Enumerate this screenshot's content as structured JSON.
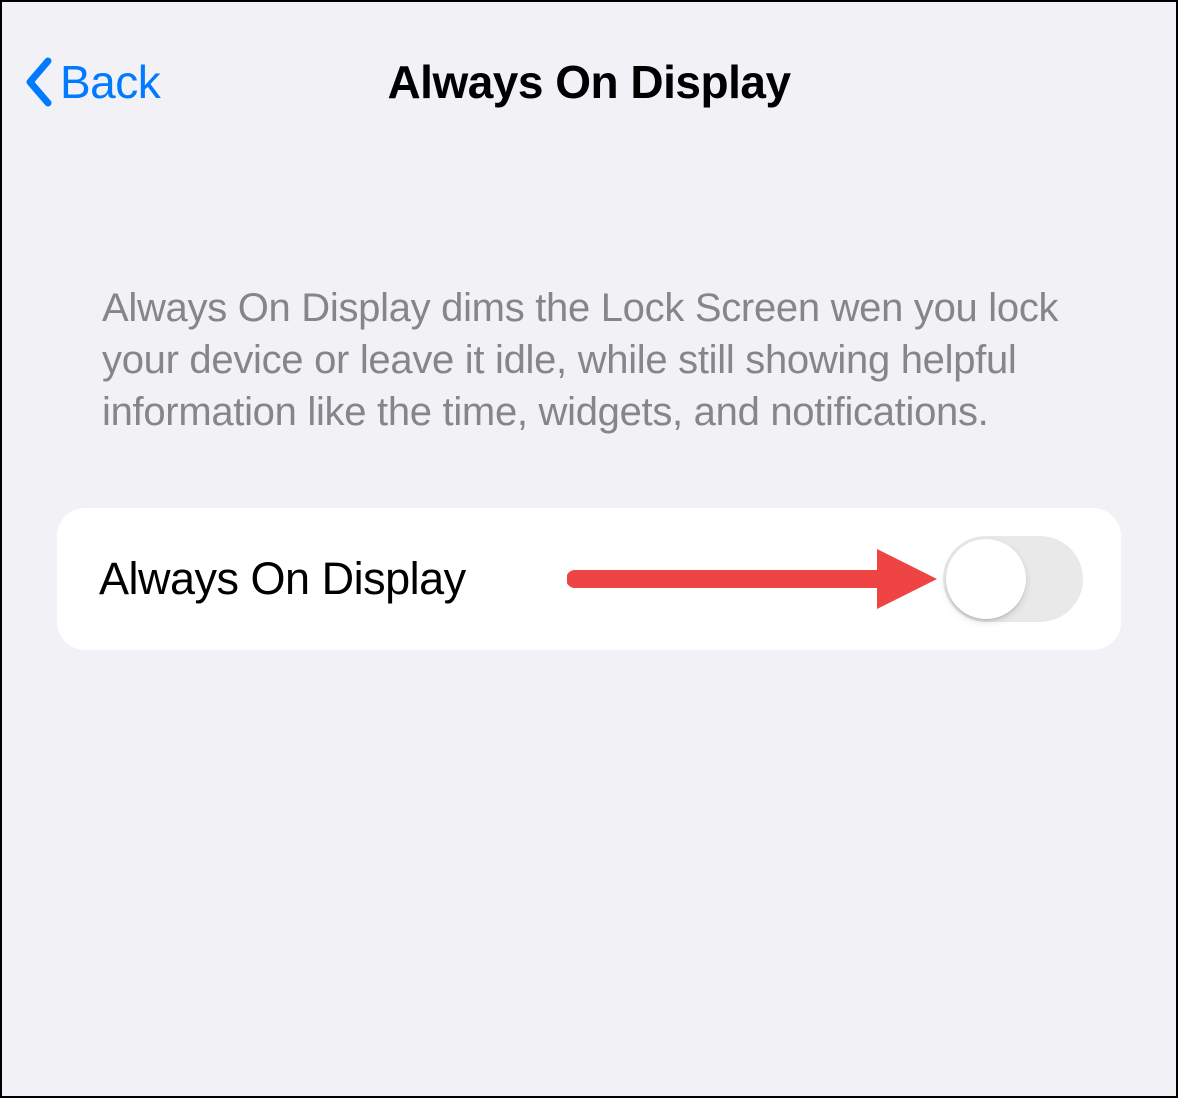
{
  "nav": {
    "back_label": "Back",
    "title": "Always On Display"
  },
  "description": "Always On Display dims the Lock Screen wen you lock your device or leave it idle, while still showing helpful information like the time, widgets, and notifications.",
  "row": {
    "label": "Always On Display",
    "toggle_on": false
  },
  "colors": {
    "accent": "#007aff",
    "background": "#f2f1f6",
    "text_secondary": "#86858a",
    "toggle_off_track": "#e9e9ea",
    "annotation": "#ef4444"
  }
}
